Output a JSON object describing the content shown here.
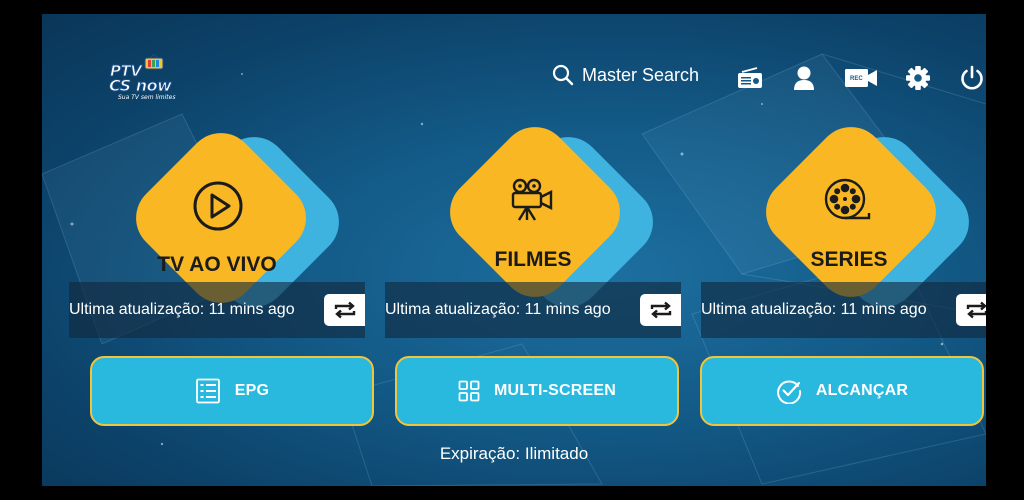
{
  "logo": {
    "line1": "PTV",
    "line2": "CS now",
    "tagline": "Sua TV sem limites"
  },
  "header": {
    "search_label": "Master Search",
    "icons": [
      "radio-icon",
      "user-icon",
      "rec-icon",
      "gear-icon",
      "power-icon"
    ],
    "rec_text": "REC"
  },
  "cards": [
    {
      "title": "TV AO VIVO",
      "icon": "play-icon",
      "update": "Ultima atualização: 11 mins ago"
    },
    {
      "title": "FILMES",
      "icon": "movie-camera-icon",
      "update": "Ultima atualização: 11 mins ago"
    },
    {
      "title": "SERIES",
      "icon": "film-reel-icon",
      "update": "Ultima atualização: 11 mins ago"
    }
  ],
  "buttons": [
    {
      "label": "EPG",
      "icon": "list-icon"
    },
    {
      "label": "MULTI-SCREEN",
      "icon": "grid-icon"
    },
    {
      "label": "ALCANÇAR",
      "icon": "check-circle-icon"
    }
  ],
  "footer": {
    "expiry": "Expiração: Ilimitado"
  },
  "colors": {
    "card_yellow": "#f8b723",
    "card_blue": "#3fb3e0",
    "button_bg": "#29b9df",
    "button_border": "#f0c43b"
  }
}
